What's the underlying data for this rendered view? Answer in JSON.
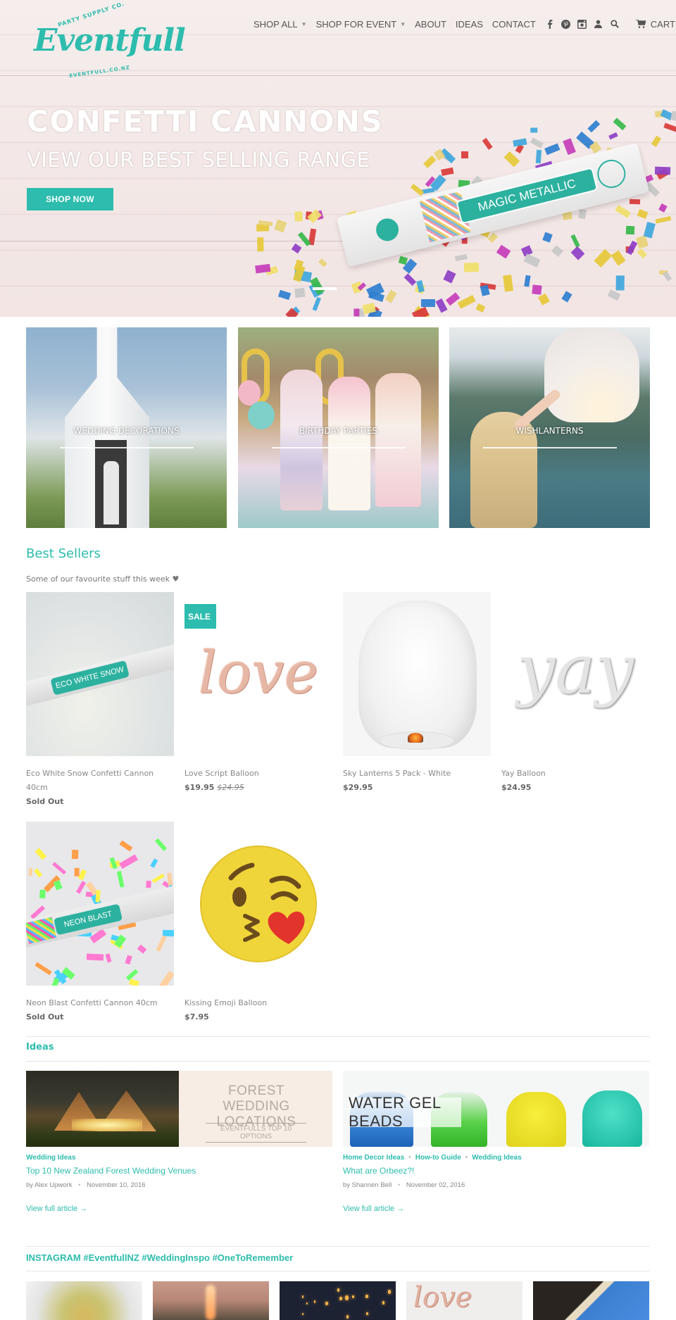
{
  "brand": {
    "top_text": "PARTY SUPPLY CO.",
    "name": "Eventfull",
    "bottom_text": "EVENTFULL.CO.NZ",
    "accent_color": "#2dbcad"
  },
  "nav": {
    "items": [
      {
        "label": "SHOP ALL",
        "has_dropdown": true
      },
      {
        "label": "SHOP FOR EVENT",
        "has_dropdown": true
      },
      {
        "label": "ABOUT",
        "has_dropdown": false
      },
      {
        "label": "IDEAS",
        "has_dropdown": false
      },
      {
        "label": "CONTACT",
        "has_dropdown": false
      }
    ],
    "caret": "▼",
    "icons": [
      "facebook-icon",
      "pinterest-icon",
      "instagram-icon",
      "account-icon",
      "search-icon"
    ],
    "cart_label": "CART"
  },
  "hero": {
    "title": "CONFETTI CANNONS",
    "subtitle": "VIEW OUR BEST SELLING RANGE",
    "button_label": "SHOP NOW",
    "product_label": "MAGIC METALLIC",
    "active_slide": 1
  },
  "categories": [
    {
      "label": "WEDDING DECORATIONS"
    },
    {
      "label": "BIRTHDAY PARTIES"
    },
    {
      "label": "WISHLANTERNS"
    }
  ],
  "best_sellers": {
    "title": "Best Sellers",
    "subtitle": "Some of our favourite stuff this week ♥",
    "products": [
      {
        "name": "Eco White Snow Confetti Cannon 40cm",
        "price": "",
        "old_price": "",
        "status": "Sold Out",
        "badge": "",
        "image_label": "ECO WHITE SNOW"
      },
      {
        "name": "Love Script Balloon",
        "price": "$19.95",
        "old_price": "$24.95",
        "status": "",
        "badge": "SALE",
        "image_label": "love"
      },
      {
        "name": "Sky Lanterns 5 Pack - White",
        "price": "$29.95",
        "old_price": "",
        "status": "",
        "badge": "",
        "image_label": ""
      },
      {
        "name": "Yay Balloon",
        "price": "$24.95",
        "old_price": "",
        "status": "",
        "badge": "",
        "image_label": "yay"
      },
      {
        "name": "Neon Blast Confetti Cannon 40cm",
        "price": "",
        "old_price": "",
        "status": "Sold Out",
        "badge": "",
        "image_label": "NEON BLAST"
      },
      {
        "name": "Kissing Emoji Balloon",
        "price": "$7.95",
        "old_price": "",
        "status": "",
        "badge": "",
        "image_label": ""
      }
    ]
  },
  "ideas": {
    "title": "Ideas",
    "articles": [
      {
        "image_heading": "FOREST WEDDING LOCATIONS",
        "image_subheading": "EVENTFULLS TOP 10 OPTIONS",
        "tags": [
          "Wedding Ideas"
        ],
        "title": "Top 10 New Zealand Forest Wedding Venues",
        "author": "by Alex Upwork",
        "date": "November 10, 2016",
        "more_label": "View full article →"
      },
      {
        "image_heading": "WATER GEL BEADS",
        "image_subheading": "",
        "tags": [
          "Home Decor Ideas",
          "How-to Guide",
          "Wedding Ideas"
        ],
        "title": "What are Orbeez?!",
        "author": "by Shannen Bell",
        "date": "November 02, 2016",
        "more_label": "View full article →"
      }
    ],
    "meta_separator": "•"
  },
  "instagram": {
    "title": "INSTAGRAM #EventfullNZ #WeddingInspo #OneToRemember",
    "tiles": 5
  }
}
